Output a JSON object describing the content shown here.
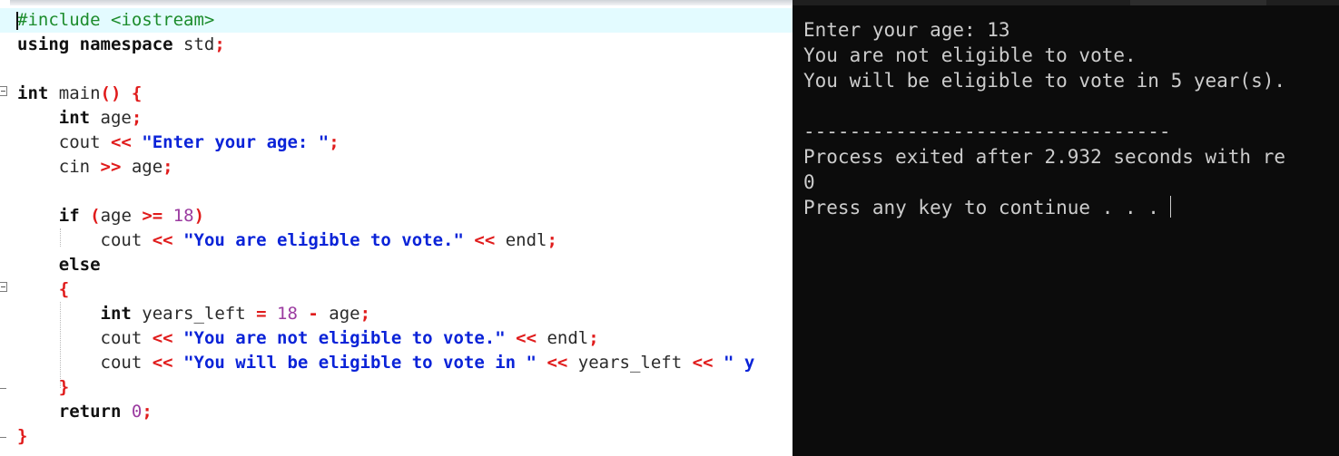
{
  "editor": {
    "lines": [
      [
        {
          "t": "pp",
          "v": "#include <iostream>"
        }
      ],
      [
        {
          "t": "kw",
          "v": "using namespace"
        },
        {
          "t": "id",
          "v": " std"
        },
        {
          "t": "op",
          "v": ";"
        }
      ],
      [],
      [
        {
          "t": "kw",
          "v": "int"
        },
        {
          "t": "id",
          "v": " main"
        },
        {
          "t": "op",
          "v": "()"
        },
        {
          "t": "id",
          "v": " "
        },
        {
          "t": "op",
          "v": "{"
        }
      ],
      [
        {
          "t": "id",
          "v": "    "
        },
        {
          "t": "kw",
          "v": "int"
        },
        {
          "t": "id",
          "v": " age"
        },
        {
          "t": "op",
          "v": ";"
        }
      ],
      [
        {
          "t": "id",
          "v": "    cout "
        },
        {
          "t": "op",
          "v": "<<"
        },
        {
          "t": "id",
          "v": " "
        },
        {
          "t": "str",
          "v": "\"Enter your age: \""
        },
        {
          "t": "op",
          "v": ";"
        }
      ],
      [
        {
          "t": "id",
          "v": "    cin "
        },
        {
          "t": "op",
          "v": ">>"
        },
        {
          "t": "id",
          "v": " age"
        },
        {
          "t": "op",
          "v": ";"
        }
      ],
      [],
      [
        {
          "t": "id",
          "v": "    "
        },
        {
          "t": "kw",
          "v": "if"
        },
        {
          "t": "id",
          "v": " "
        },
        {
          "t": "op",
          "v": "("
        },
        {
          "t": "id",
          "v": "age "
        },
        {
          "t": "op",
          "v": ">="
        },
        {
          "t": "id",
          "v": " "
        },
        {
          "t": "num",
          "v": "18"
        },
        {
          "t": "op",
          "v": ")"
        }
      ],
      [
        {
          "t": "id",
          "v": "        cout "
        },
        {
          "t": "op",
          "v": "<<"
        },
        {
          "t": "id",
          "v": " "
        },
        {
          "t": "str",
          "v": "\"You are eligible to vote.\""
        },
        {
          "t": "id",
          "v": " "
        },
        {
          "t": "op",
          "v": "<<"
        },
        {
          "t": "id",
          "v": " endl"
        },
        {
          "t": "op",
          "v": ";"
        }
      ],
      [
        {
          "t": "id",
          "v": "    "
        },
        {
          "t": "kw",
          "v": "else"
        }
      ],
      [
        {
          "t": "id",
          "v": "    "
        },
        {
          "t": "op",
          "v": "{"
        }
      ],
      [
        {
          "t": "id",
          "v": "        "
        },
        {
          "t": "kw",
          "v": "int"
        },
        {
          "t": "id",
          "v": " years_left "
        },
        {
          "t": "op",
          "v": "="
        },
        {
          "t": "id",
          "v": " "
        },
        {
          "t": "num",
          "v": "18"
        },
        {
          "t": "id",
          "v": " "
        },
        {
          "t": "op",
          "v": "-"
        },
        {
          "t": "id",
          "v": " age"
        },
        {
          "t": "op",
          "v": ";"
        }
      ],
      [
        {
          "t": "id",
          "v": "        cout "
        },
        {
          "t": "op",
          "v": "<<"
        },
        {
          "t": "id",
          "v": " "
        },
        {
          "t": "str",
          "v": "\"You are not eligible to vote.\""
        },
        {
          "t": "id",
          "v": " "
        },
        {
          "t": "op",
          "v": "<<"
        },
        {
          "t": "id",
          "v": " endl"
        },
        {
          "t": "op",
          "v": ";"
        }
      ],
      [
        {
          "t": "id",
          "v": "        cout "
        },
        {
          "t": "op",
          "v": "<<"
        },
        {
          "t": "id",
          "v": " "
        },
        {
          "t": "str",
          "v": "\"You will be eligible to vote in \""
        },
        {
          "t": "id",
          "v": " "
        },
        {
          "t": "op",
          "v": "<<"
        },
        {
          "t": "id",
          "v": " years_left "
        },
        {
          "t": "op",
          "v": "<<"
        },
        {
          "t": "id",
          "v": " "
        },
        {
          "t": "str",
          "v": "\" y"
        }
      ],
      [
        {
          "t": "id",
          "v": "    "
        },
        {
          "t": "op",
          "v": "}"
        }
      ],
      [
        {
          "t": "id",
          "v": "    "
        },
        {
          "t": "kw",
          "v": "return"
        },
        {
          "t": "id",
          "v": " "
        },
        {
          "t": "num",
          "v": "0"
        },
        {
          "t": "op",
          "v": ";"
        }
      ],
      [
        {
          "t": "op",
          "v": "}"
        }
      ]
    ]
  },
  "console": {
    "lines": [
      "Enter your age: 13",
      "You are not eligible to vote.",
      "You will be eligible to vote in 5 year(s).",
      "",
      "--------------------------------",
      "Process exited after 2.932 seconds with re",
      "0",
      "Press any key to continue . . ."
    ]
  },
  "colors": {
    "keyword": "#111111",
    "preprocessor": "#1c8c2c",
    "string": "#0a23d8",
    "number": "#9b3ba0",
    "operator": "#e01b1b",
    "console_bg": "#0c0c0c",
    "console_text": "#cccccc",
    "highlight_line": "#e3fbff"
  }
}
